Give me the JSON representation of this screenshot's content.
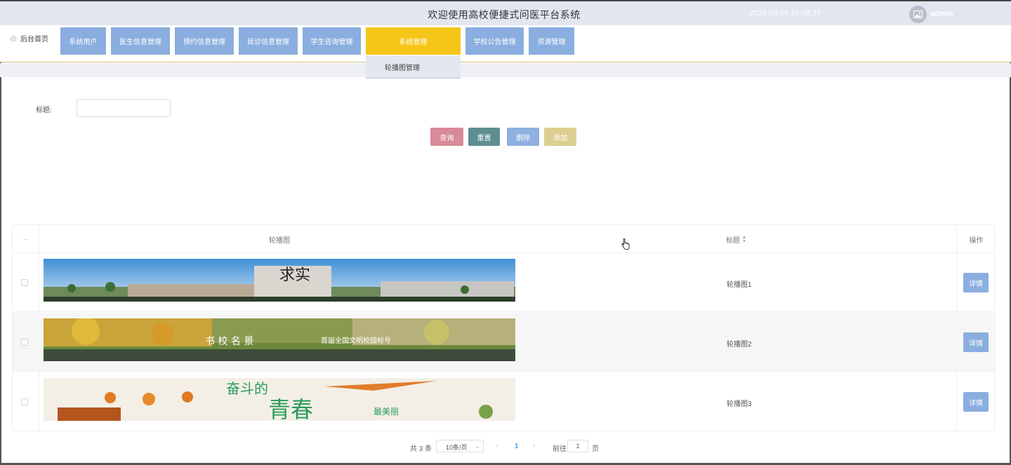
{
  "header": {
    "title": "欢迎使用高校便捷式问医平台系统",
    "datetime": "2024-03-05 10:08:37",
    "username": "admin"
  },
  "nav": {
    "home": "后台首页",
    "items": [
      "系统用户",
      "医生信息管理",
      "预约信息管理",
      "就诊信息管理",
      "学生咨询管理",
      "系统管理",
      "学校公告管理",
      "资源管理"
    ],
    "active_index": 5,
    "dropdown_item": "轮播图管理"
  },
  "search": {
    "title_label": "标题:",
    "title_value": "",
    "buttons": {
      "query": "查询",
      "reset": "重置",
      "delete": "删除",
      "add": "添加"
    }
  },
  "table": {
    "columns": {
      "image": "轮播图",
      "title": "标题",
      "action": "操作"
    },
    "rows": [
      {
        "title": "轮播图1",
        "action": "详情",
        "banner_text": "求实"
      },
      {
        "title": "轮播图2",
        "action": "详情",
        "banner_text": "书 校 名 景",
        "banner_subtext": "首届全国文明校园标号"
      },
      {
        "title": "轮播图3",
        "action": "详情",
        "banner_text": "奋斗的",
        "banner_text2": "青春",
        "banner_text3": "最美丽"
      }
    ]
  },
  "pagination": {
    "total": "共 3 条",
    "page_size": "10条/页",
    "current_page": "1",
    "goto_label": "前往",
    "goto_value": "1",
    "page_unit": "页"
  },
  "colors": {
    "header_bg": "#e1e6ef",
    "nav_button": "#8aaedf",
    "nav_active": "#f5c518",
    "btn_query": "#d88a98",
    "btn_reset": "#5f8e90",
    "btn_delete": "#8fb0e0",
    "btn_add": "#dccf91"
  }
}
